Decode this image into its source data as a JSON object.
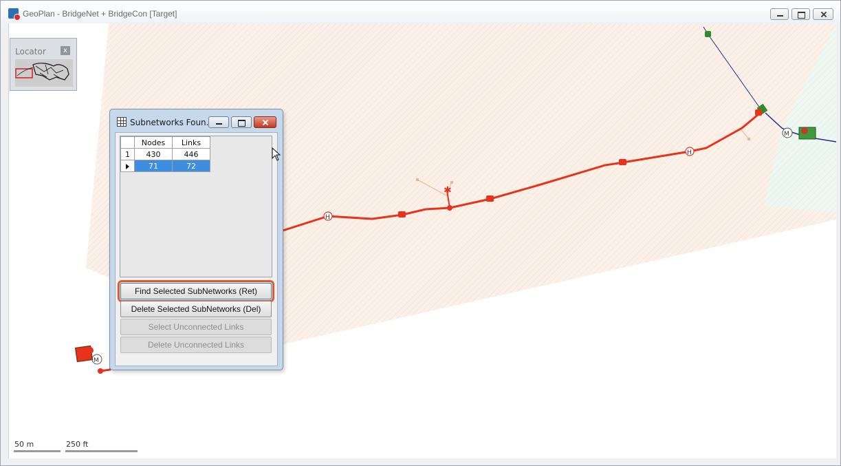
{
  "window": {
    "title": "GeoPlan - BridgeNet + BridgeCon [Target]",
    "icon": "geoplan-app-icon",
    "buttons": [
      "minimize-icon",
      "maximize-icon",
      "close-icon"
    ]
  },
  "locator": {
    "title": "Locator",
    "close_label": "x"
  },
  "scale": {
    "metric_label": "50 m",
    "imperial_label": "250 ft"
  },
  "dialog": {
    "title": "Subnetworks Foun...",
    "grid": {
      "columns": [
        "Nodes",
        "Links"
      ],
      "rows": [
        {
          "index": "1",
          "nodes": "430",
          "links": "446",
          "selected": false
        },
        {
          "index": "",
          "nodes": "71",
          "links": "72",
          "selected": true
        }
      ]
    },
    "buttons": {
      "find": "Find Selected SubNetworks (Ret)",
      "delete": "Delete Selected SubNetworks (Del)",
      "select_unconnected": "Select Unconnected Links",
      "delete_unconnected": "Delete Unconnected Links"
    }
  },
  "map_labels": {
    "meter_symbol": "M",
    "hydrant_symbol": "H",
    "colors": {
      "selected_network": "#e8321e",
      "other_network": "#1f2d8a",
      "node_green": "#2e8b2e",
      "hatch_fill": "#fbeee3"
    }
  }
}
